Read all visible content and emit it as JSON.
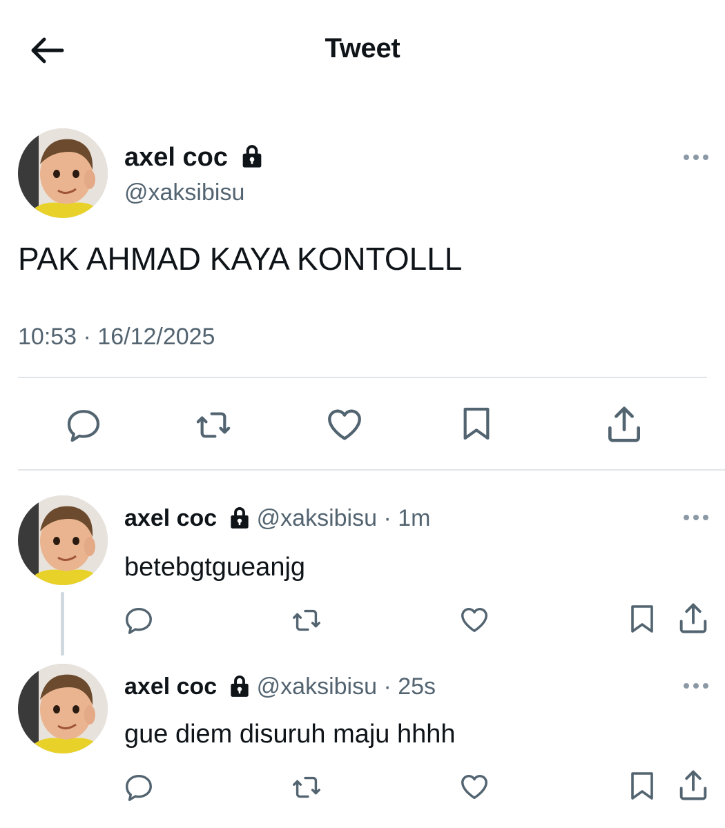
{
  "header": {
    "title": "Tweet",
    "back_icon": "arrow-left-icon"
  },
  "main_tweet": {
    "author_name": "axel coc",
    "author_handle": "@xaksibisu",
    "protected_icon": "lock-icon",
    "text": "PAK AHMAD KAYA KONTOLLL",
    "timestamp": "10:53 · 16/12/2025",
    "actions": [
      "reply-icon",
      "retweet-icon",
      "like-icon",
      "bookmark-icon",
      "share-icon"
    ]
  },
  "replies": [
    {
      "author_name": "axel coc",
      "handle_time": "@xaksibisu · 1m",
      "text": "betebgtgueanjg"
    },
    {
      "author_name": "axel coc",
      "handle_time": "@xaksibisu · 25s",
      "text": "gue diem disuruh maju hhhh"
    }
  ],
  "colors": {
    "text_primary": "#0f1419",
    "text_secondary": "#536471",
    "icon": "#536471",
    "divider": "#e1e5e8"
  }
}
